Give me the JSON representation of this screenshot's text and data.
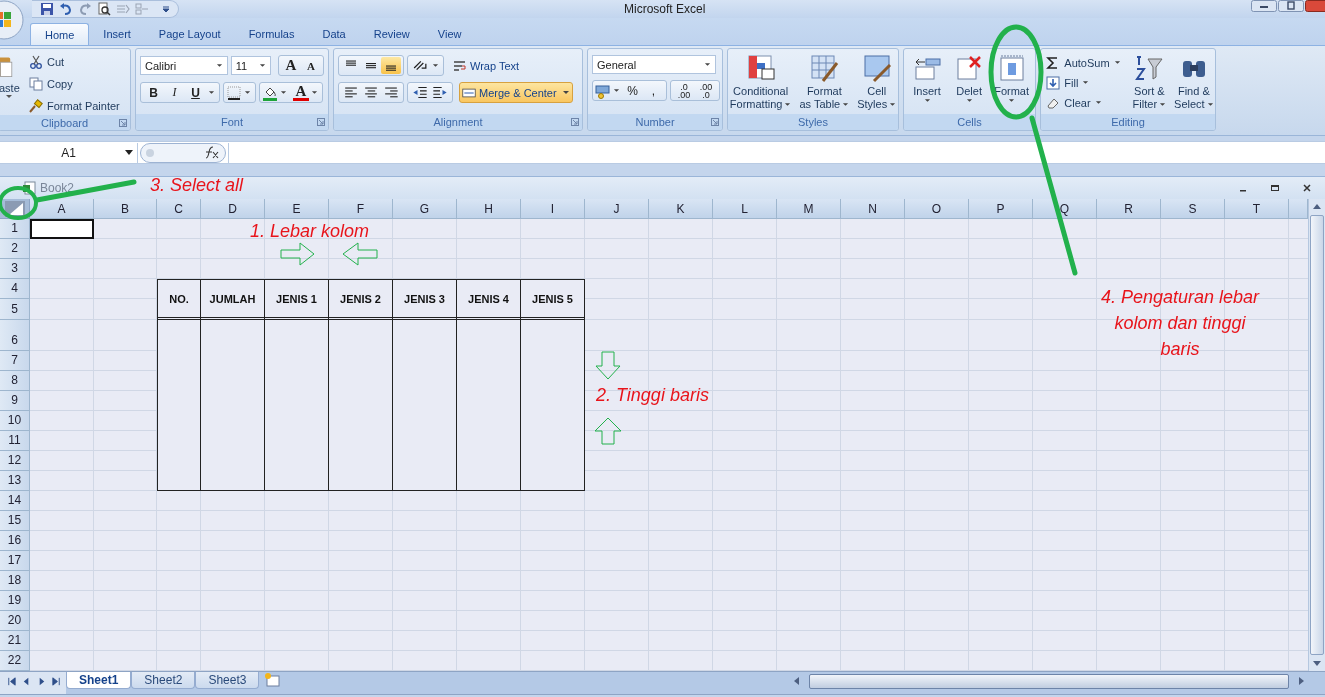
{
  "title_bar": {
    "title": "Microsoft Excel"
  },
  "ribbon_tabs": [
    {
      "label": "Home",
      "selected": true
    },
    {
      "label": "Insert",
      "selected": false
    },
    {
      "label": "Page Layout",
      "selected": false
    },
    {
      "label": "Formulas",
      "selected": false
    },
    {
      "label": "Data",
      "selected": false
    },
    {
      "label": "Review",
      "selected": false
    },
    {
      "label": "View",
      "selected": false
    }
  ],
  "clipboard": {
    "paste": "aste",
    "commands": [
      "Cut",
      "Copy",
      "Format Painter"
    ],
    "label": "Clipboard"
  },
  "font": {
    "family": "Calibri",
    "size": "11",
    "size_buttons": [
      "A",
      "A"
    ],
    "styles": [
      "B",
      "I",
      "U"
    ],
    "font_color": "A",
    "label": "Font"
  },
  "alignment": {
    "vertical": [
      {
        "selected": false
      },
      {
        "selected": false
      },
      {
        "selected": true
      }
    ],
    "wrap_text": {
      "label": "Wrap Text",
      "on": false
    },
    "merge_center": {
      "label": "Merge & Center",
      "on": true
    },
    "label": "Alignment"
  },
  "number": {
    "format": "General",
    "symbols": [
      "%",
      ","
    ],
    "decimals": [
      [
        ".0",
        ".00"
      ],
      [
        ".00",
        ".0"
      ]
    ],
    "label": "Number"
  },
  "styles": {
    "buttons": [
      [
        "Conditional",
        "Formatting"
      ],
      [
        "Format",
        "as Table"
      ],
      [
        "Cell",
        "Styles"
      ]
    ],
    "label": "Styles"
  },
  "cells": {
    "buttons": [
      "Insert",
      "Delet",
      "Format"
    ],
    "label": "Cells"
  },
  "editing": {
    "commands": [
      "AutoSum",
      "Fill",
      "Clear"
    ],
    "buttons": [
      [
        "Sort &",
        "Filter"
      ],
      [
        "Find &",
        "Select"
      ]
    ],
    "label": "Editing"
  },
  "formula_bar": {
    "name_box": "A1"
  },
  "workbook": {
    "title": "Book2"
  },
  "sheet": {
    "columns": [
      "A",
      "B",
      "C",
      "D",
      "E",
      "F",
      "G",
      "H",
      "I",
      "J",
      "K",
      "L",
      "M",
      "N",
      "O",
      "P",
      "Q",
      "R",
      "S",
      "T"
    ],
    "rows": [
      "1",
      "2",
      "3",
      "4",
      "5",
      "6",
      "7",
      "8",
      "9",
      "10",
      "11",
      "12",
      "13",
      "14",
      "15",
      "16",
      "17",
      "18",
      "19",
      "20",
      "21",
      "22"
    ],
    "table_headers": [
      "NO.",
      "JUMLAH",
      "JENIS 1",
      "JENIS 2",
      "JENIS 3",
      "JENIS 4",
      "JENIS 5"
    ]
  },
  "sheet_tabs": [
    {
      "label": "Sheet1",
      "selected": true
    },
    {
      "label": "Sheet2",
      "selected": false
    },
    {
      "label": "Sheet3",
      "selected": false
    }
  ],
  "annotations": [
    {
      "text": "1. Lebar kolom"
    },
    {
      "text": "2. Tinggi baris"
    },
    {
      "text": "3. Select all"
    },
    {
      "text": "4. Pengaturan lebar kolom dan tinggi baris"
    }
  ]
}
